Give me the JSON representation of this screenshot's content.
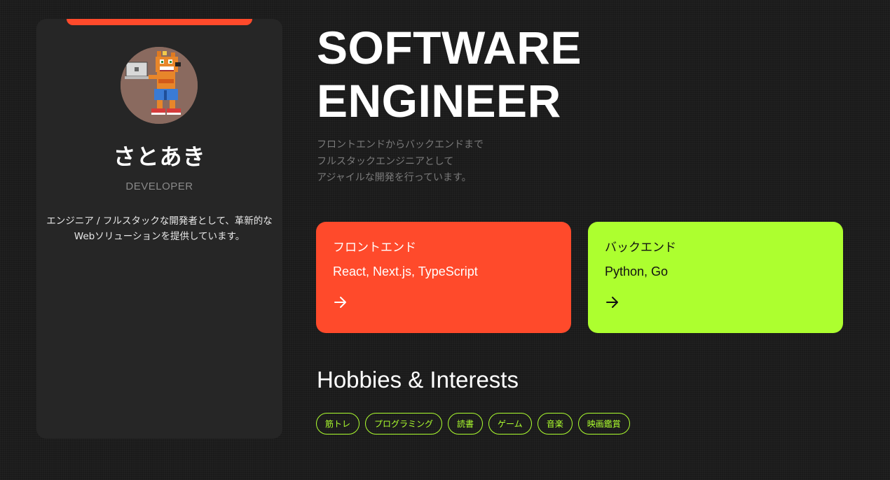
{
  "profile": {
    "name": "さとあき",
    "role": "DEVELOPER",
    "bio": "エンジニア / フルスタックな開発者として、革新的なWebソリューションを提供しています。",
    "accent_color": "#ff4a2b",
    "avatar_icon": "pixel-fox-holding-laptop"
  },
  "hero": {
    "title_lines": [
      "SOFTWARE",
      "ENGINEER"
    ],
    "description_lines": [
      "フロントエンドからバックエンドまで",
      "フルスタックエンジニアとして",
      "アジャイルな開発を行っています。"
    ]
  },
  "skills": [
    {
      "title": "フロントエンド",
      "tech": "React, Next.js, TypeScript",
      "color": "#ff4a2b",
      "icon": "arrow-right-icon"
    },
    {
      "title": "バックエンド",
      "tech": "Python, Go",
      "color": "#adff2f",
      "icon": "arrow-right-icon"
    }
  ],
  "hobbies": {
    "heading": "Hobbies & Interests",
    "tags": [
      "筋トレ",
      "プログラミング",
      "読書",
      "ゲーム",
      "音楽",
      "映画鑑賞"
    ],
    "tag_color": "#adff2f"
  }
}
